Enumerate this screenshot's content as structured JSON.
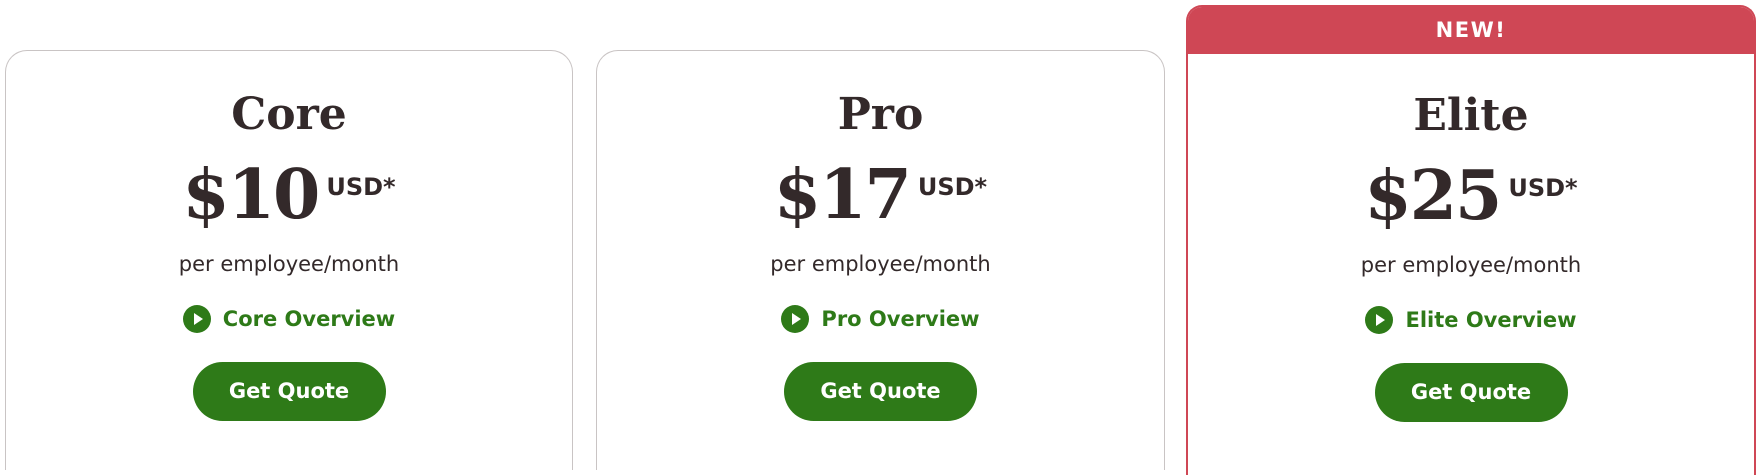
{
  "plans": [
    {
      "name": "Core",
      "price": "$10",
      "currency": "USD*",
      "per_unit": "per employee/month",
      "overview_label": "Core Overview",
      "cta_label": "Get Quote"
    },
    {
      "name": "Pro",
      "price": "$17",
      "currency": "USD*",
      "per_unit": "per employee/month",
      "overview_label": "Pro Overview",
      "cta_label": "Get Quote"
    },
    {
      "name": "Elite",
      "badge": "NEW!",
      "price": "$25",
      "currency": "USD*",
      "per_unit": "per employee/month",
      "overview_label": "Elite Overview",
      "cta_label": "Get Quote"
    }
  ],
  "colors": {
    "brand_green": "#2e7a18",
    "badge_red": "#cf4755",
    "text_dark": "#33292a",
    "card_border": "#c9c4c4"
  },
  "icons": {
    "overview": "play-circle-icon"
  }
}
